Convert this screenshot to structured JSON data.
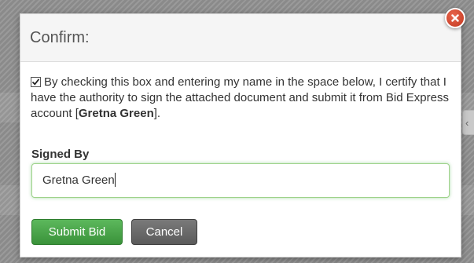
{
  "dialog": {
    "title": "Confirm:",
    "consent_text_before": "By checking this box and entering my name in the space below, I certify that I have the authority to sign the attached document and submit it from Bid Express account [",
    "account_name": "Gretna Green",
    "consent_text_after": "].",
    "consent_checked": true,
    "signed_by_label": "Signed By",
    "signed_by_value": "Gretna Green",
    "submit_label": "Submit Bid",
    "cancel_label": "Cancel",
    "close_icon": "close-icon"
  },
  "background": {
    "arrow_glyph": "‹"
  },
  "colors": {
    "submit_button": "#4cae4c",
    "cancel_button": "#6a6a6a",
    "close_button": "#d9534f",
    "input_focus_border": "#9ed28a"
  }
}
